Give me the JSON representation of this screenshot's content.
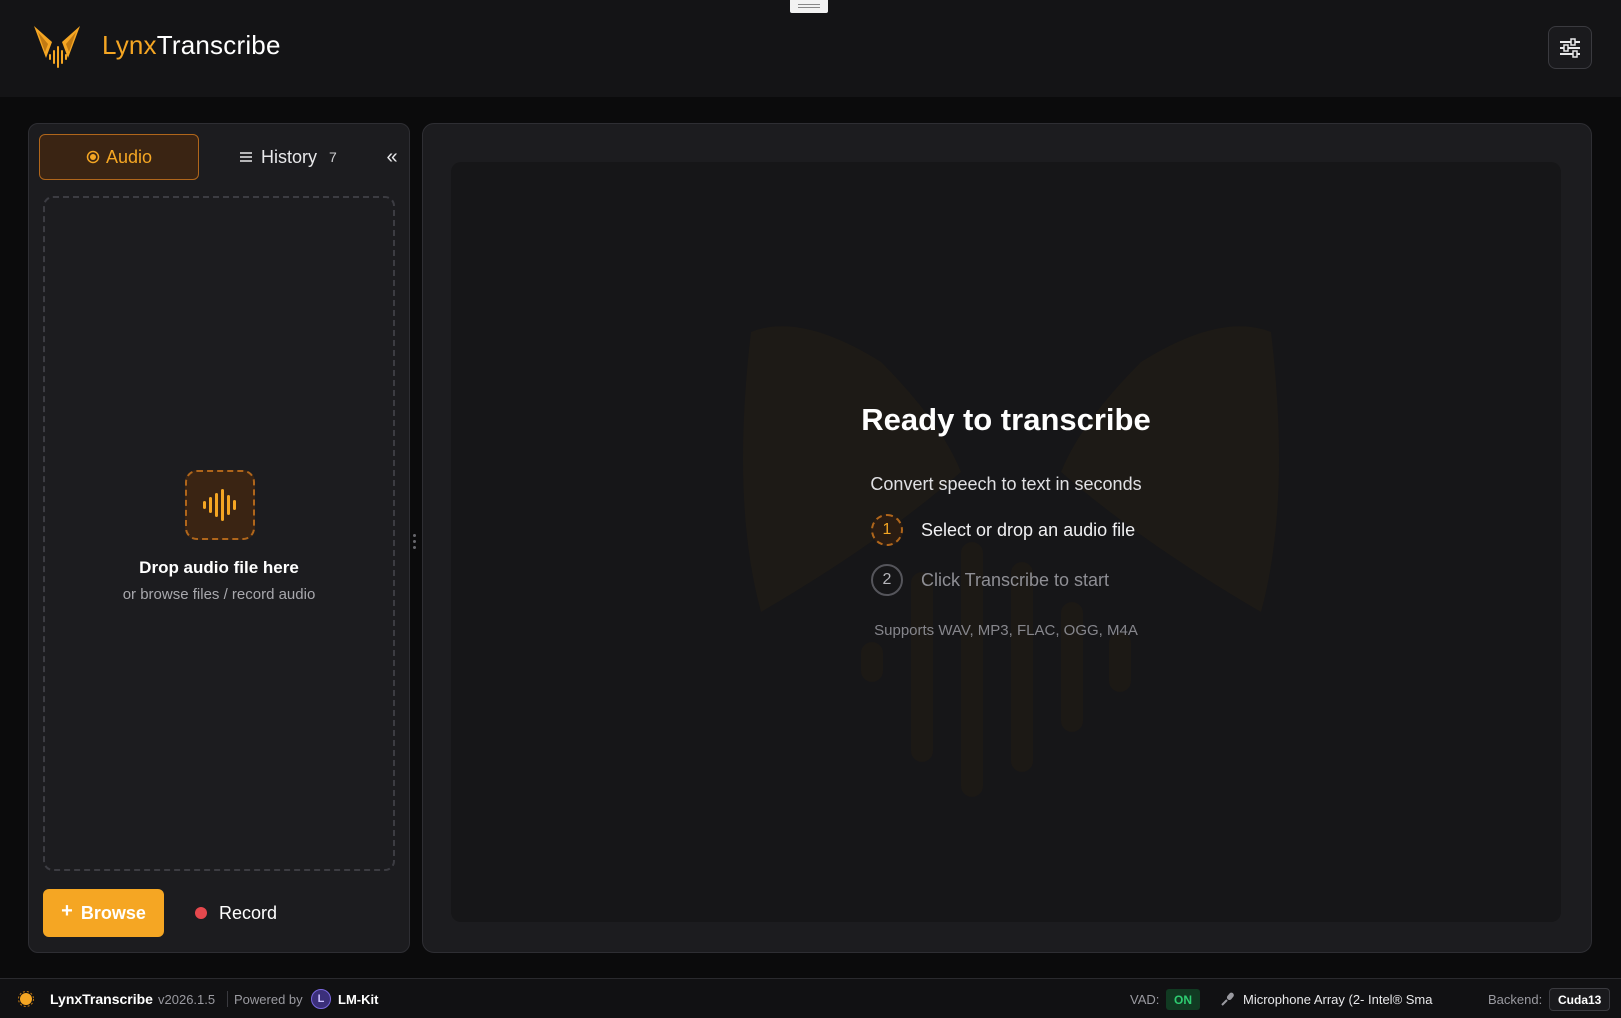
{
  "app": {
    "brand_part1": "Lynx",
    "brand_part2": "Transcribe",
    "accent_color": "#f5a623"
  },
  "header": {
    "settings_icon": "sliders-icon"
  },
  "left_panel": {
    "tabs": {
      "audio": {
        "icon": "radio-dot-icon",
        "label": "Audio"
      },
      "history": {
        "icon": "list-icon",
        "label": "History",
        "count": "7"
      },
      "collapse": "«"
    },
    "dropzone": {
      "icon": "waveform-icon",
      "title": "Drop audio file here",
      "subtitle": "or browse files / record audio"
    },
    "actions": {
      "browse_icon": "+",
      "browse_label": "Browse",
      "record_label": "Record"
    }
  },
  "main": {
    "title": "Ready to transcribe",
    "subtitle": "Convert speech to text in seconds",
    "steps": [
      {
        "num": "1",
        "text": "Select or drop an audio file"
      },
      {
        "num": "2",
        "text": "Click Transcribe to start"
      }
    ],
    "supports": "Supports WAV, MP3, FLAC, OGG, M4A"
  },
  "statusbar": {
    "app_name": "LynxTranscribe",
    "version": "v2026.1.5",
    "powered_by": "Powered by",
    "lmkit_icon_letter": "L",
    "lmkit": "LM-Kit",
    "vad_label": "VAD:",
    "vad_value": "ON",
    "mic_icon": "microphone-icon",
    "mic_name": "Microphone Array (2- Intel® Sma",
    "backend_label": "Backend:",
    "backend_value": "Cuda13"
  }
}
